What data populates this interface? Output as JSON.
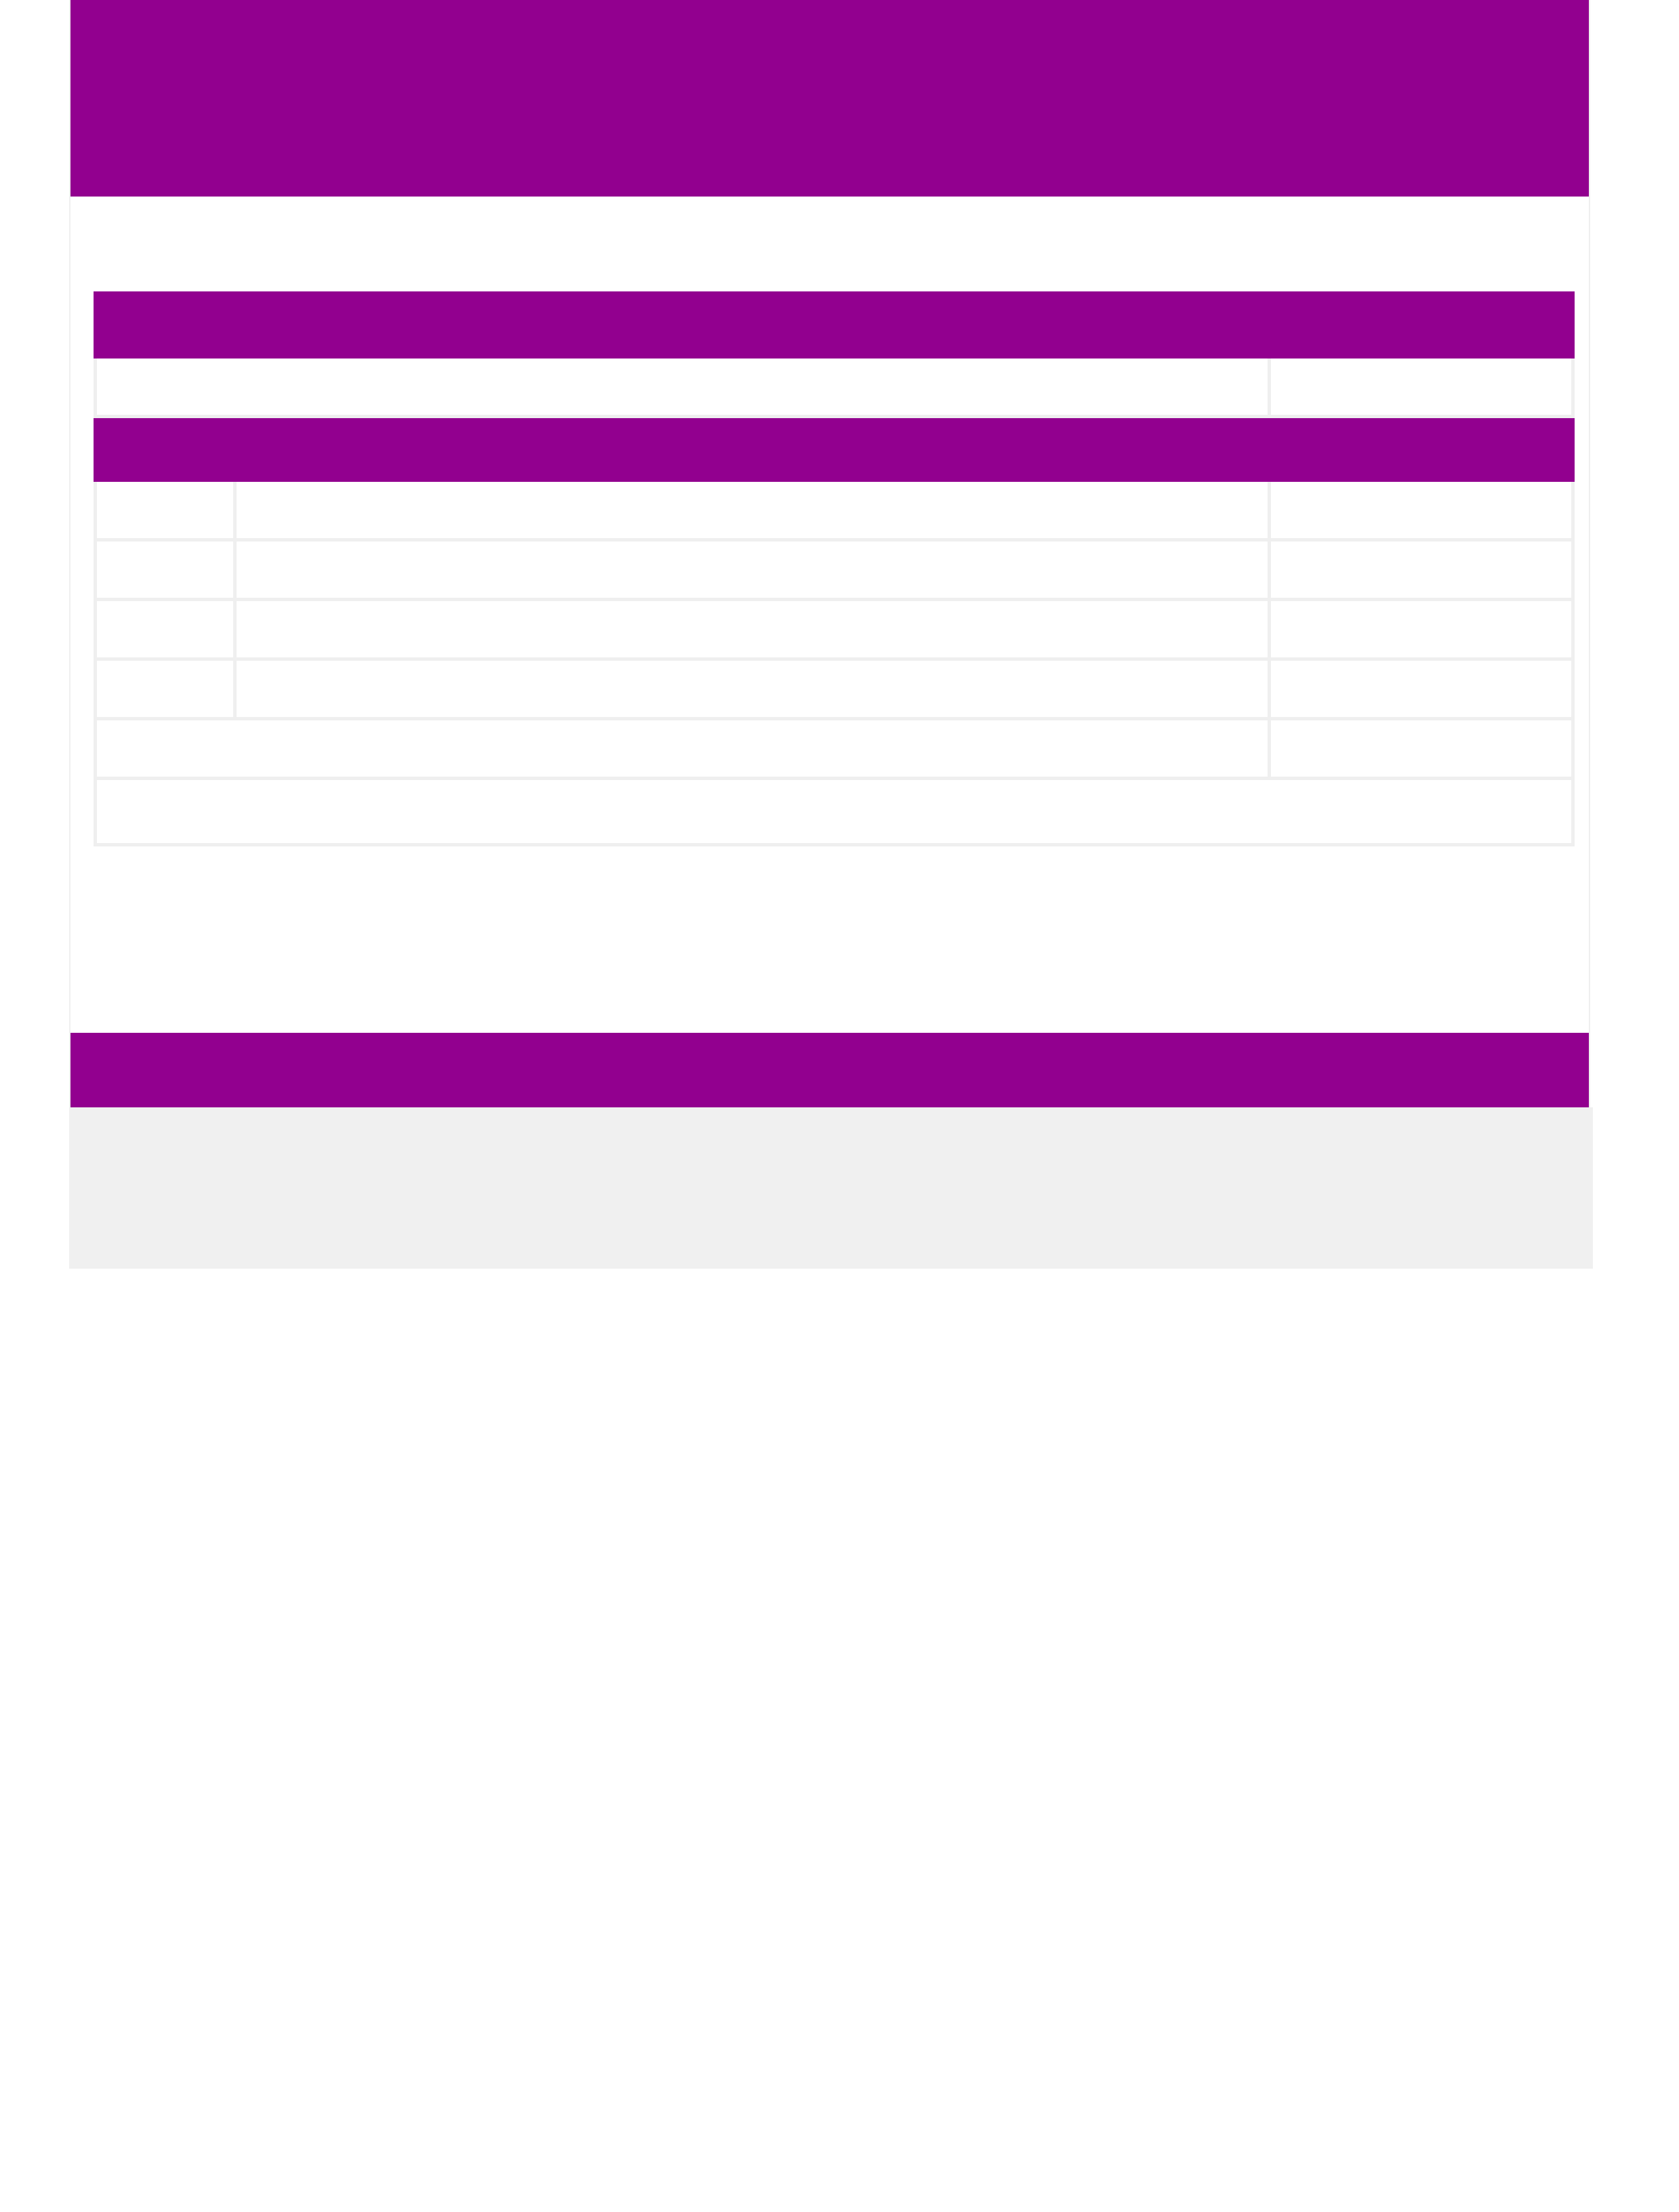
{
  "colors": {
    "brand": "#92008f",
    "border": "#efefef",
    "footer_background": "#f0f0f0",
    "background": "#ffffff"
  },
  "header": {
    "heading": ""
  },
  "order_details": {
    "section_title": "",
    "info_row": [
      "",
      ""
    ],
    "items_title": "",
    "items": [
      {
        "quantity": "",
        "product": "",
        "price": ""
      },
      {
        "quantity": "",
        "product": "",
        "price": ""
      },
      {
        "quantity": "",
        "product": "",
        "price": ""
      },
      {
        "quantity": "",
        "product": "",
        "price": ""
      }
    ],
    "total_label": "",
    "total_value": "",
    "note": ""
  },
  "footer": {
    "bar_text": "",
    "text": ""
  }
}
